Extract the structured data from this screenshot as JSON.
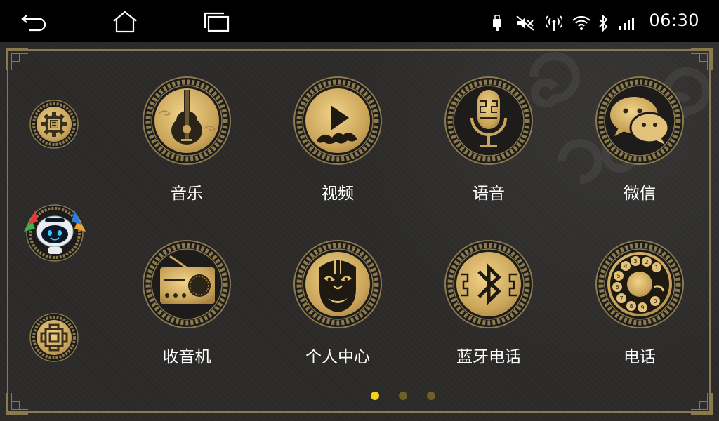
{
  "statusbar": {
    "time": "06:30",
    "nav_icons": [
      "back-icon",
      "home-icon",
      "recents-icon"
    ],
    "status_icons": [
      "usb-icon",
      "mute-icon",
      "hotspot-icon",
      "wifi-icon",
      "bluetooth-icon",
      "signal-icon"
    ]
  },
  "sidebar": {
    "items": [
      "settings-icon",
      "robot-assistant-icon",
      "knot-icon"
    ]
  },
  "apps": [
    {
      "label": "音乐",
      "icon": "guitar-icon"
    },
    {
      "label": "视频",
      "icon": "play-icon"
    },
    {
      "label": "语音",
      "icon": "microphone-icon"
    },
    {
      "label": "微信",
      "icon": "wechat-icon"
    },
    {
      "label": "收音机",
      "icon": "radio-icon"
    },
    {
      "label": "个人中心",
      "icon": "opera-mask-icon"
    },
    {
      "label": "蓝牙电话",
      "icon": "bluetooth-icon"
    },
    {
      "label": "电话",
      "icon": "rotary-dial-icon"
    }
  ],
  "pager": {
    "pages": 3,
    "active": 1
  },
  "colors": {
    "accent": "#d8b867",
    "frame": "#8c7a4f",
    "dot_active": "#f2d21a",
    "dot_inactive": "#6e5f2a"
  }
}
